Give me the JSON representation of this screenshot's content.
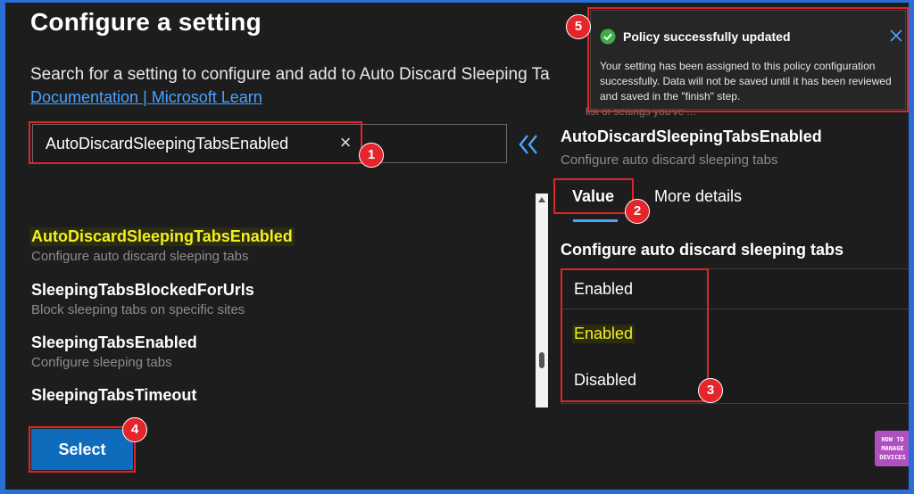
{
  "page": {
    "title": "Configure a setting",
    "description": "Search for a setting to configure and add to Auto Discard Sleeping Ta",
    "doc_link": "Documentation | Microsoft Learn"
  },
  "search": {
    "value": "AutoDiscardSleepingTabsEnabled"
  },
  "results": [
    {
      "name": "AutoDiscardSleepingTabsEnabled",
      "desc": "Configure auto discard sleeping tabs"
    },
    {
      "name": "SleepingTabsBlockedForUrls",
      "desc": "Block sleeping tabs on specific sites"
    },
    {
      "name": "SleepingTabsEnabled",
      "desc": "Configure sleeping tabs"
    },
    {
      "name": "SleepingTabsTimeout"
    }
  ],
  "select_label": "Select",
  "detail": {
    "faded_text": "list of settings you've ...",
    "title": "AutoDiscardSleepingTabsEnabled",
    "subtitle": "Configure auto discard sleeping tabs",
    "tabs": [
      "Value",
      "More details"
    ],
    "config_label": "Configure auto discard sleeping tabs",
    "dropdown": {
      "selected": "Enabled",
      "options": [
        "Enabled",
        "Disabled"
      ]
    }
  },
  "toast": {
    "title": "Policy successfully updated",
    "body": "Your setting has been assigned to this policy configuration successfully. Data will not be saved until it has been reviewed and saved in the \"finish\" step."
  },
  "badges": [
    "1",
    "2",
    "3",
    "4",
    "5"
  ],
  "logo": {
    "line1": "HOW TO",
    "line2": "MANAGE",
    "line3": "DEVICES"
  },
  "colors": {
    "accent": "#4aa3ff",
    "primary_button": "#0f6cbd",
    "highlight": "#f0f020",
    "annotation_red": "#e0242b",
    "success": "#3fae49"
  }
}
